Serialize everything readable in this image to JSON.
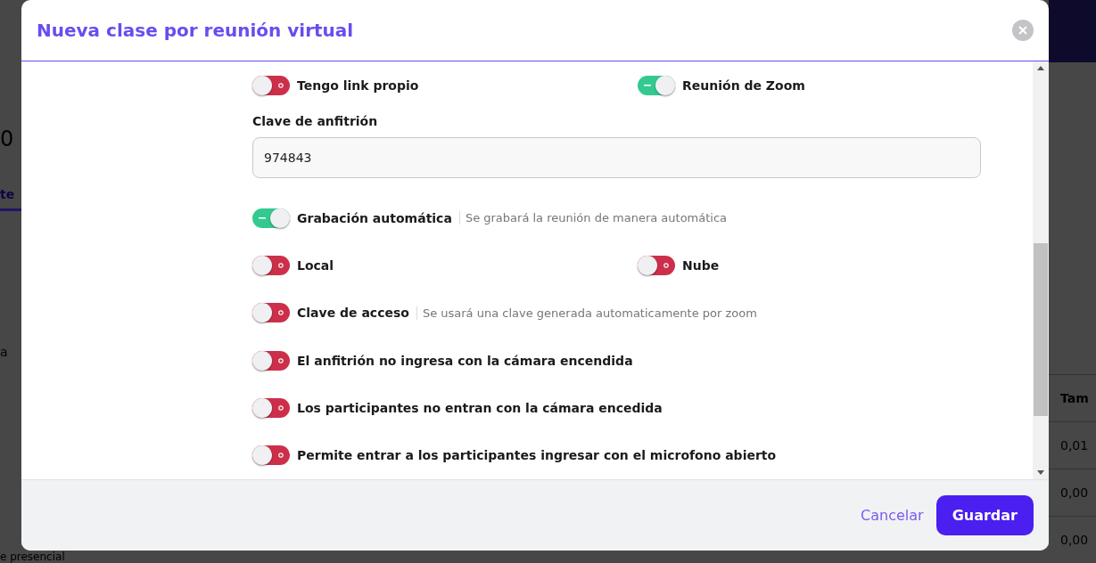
{
  "background": {
    "left_texts": [
      {
        "kind": "number",
        "text": "0"
      },
      {
        "kind": "tab",
        "text": "te"
      },
      {
        "kind": "caption",
        "text": "a"
      },
      {
        "kind": "footer",
        "text": "e presencial"
      }
    ],
    "table": {
      "column": "Tam",
      "cells": [
        "0,01",
        "0,00",
        "0,00"
      ]
    }
  },
  "dialog": {
    "title": "Nueva clase por reunión virtual",
    "fields": [
      {
        "kind": "toggle_pair",
        "items": [
          {
            "label": "Tengo link propio",
            "on": false
          },
          {
            "label": "Reunión de Zoom",
            "on": true
          }
        ]
      },
      {
        "kind": "input",
        "label": "Clave de anfitrión",
        "value": "974843"
      },
      {
        "kind": "toggle",
        "label": "Grabación automática",
        "hint": "Se grabará la reunión de manera automática",
        "on": true
      },
      {
        "kind": "toggle_pair",
        "items": [
          {
            "label": "Local",
            "on": false
          },
          {
            "label": "Nube",
            "on": false
          }
        ]
      },
      {
        "kind": "toggle",
        "label": "Clave de acceso",
        "hint": "Se usará una clave generada automaticamente por zoom",
        "on": false
      },
      {
        "kind": "toggle",
        "label": "El anfitrión no ingresa con la cámara encendida",
        "on": false
      },
      {
        "kind": "toggle",
        "label": "Los participantes no entran con la cámara encedida",
        "on": false
      },
      {
        "kind": "toggle",
        "label": "Permite entrar a los participantes ingresar con el microfono abierto",
        "on": false
      }
    ],
    "buttons": [
      {
        "kind": "link",
        "label": "Cancelar"
      },
      {
        "kind": "primary",
        "label": "Guardar"
      }
    ]
  }
}
